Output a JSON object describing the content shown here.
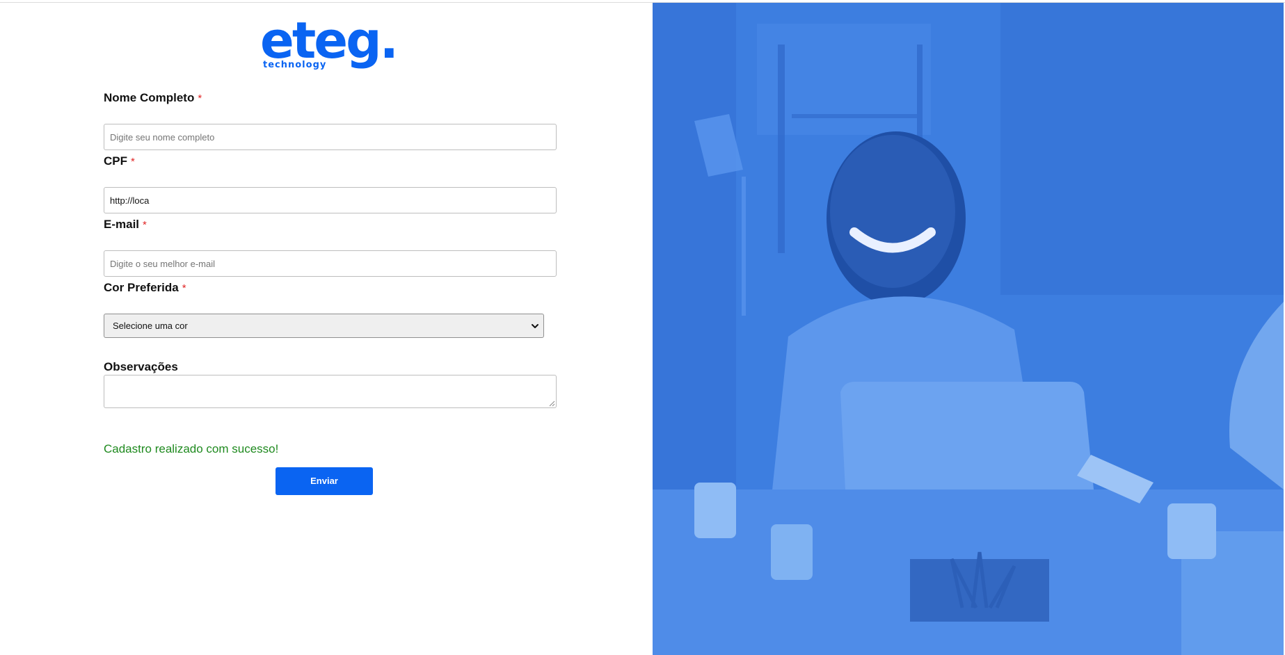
{
  "brand": {
    "logo_word": "eteg.",
    "logo_sub": "technology",
    "color": "#0a64f2"
  },
  "form": {
    "full_name": {
      "label": "Nome Completo",
      "required_mark": "*",
      "placeholder": "Digite seu nome completo",
      "value": ""
    },
    "cpf": {
      "label": "CPF",
      "required_mark": "*",
      "placeholder": "",
      "value": "http://loca"
    },
    "email": {
      "label": "E-mail",
      "required_mark": "*",
      "placeholder": "Digite o seu melhor e-mail",
      "value": ""
    },
    "favorite_color": {
      "label": "Cor Preferida",
      "required_mark": "*",
      "selected": "Selecione uma cor"
    },
    "notes": {
      "label": "Observações",
      "value": ""
    },
    "success_message": "Cadastro realizado com sucesso!",
    "submit_label": "Enviar"
  },
  "colors": {
    "accent": "#0a64f2",
    "success": "#1f8a1f",
    "required": "#e02424",
    "hero_overlay": "#3d7ee0"
  },
  "icons": {
    "select": "chevron-down-icon",
    "textarea": "resize-grip-icon"
  }
}
